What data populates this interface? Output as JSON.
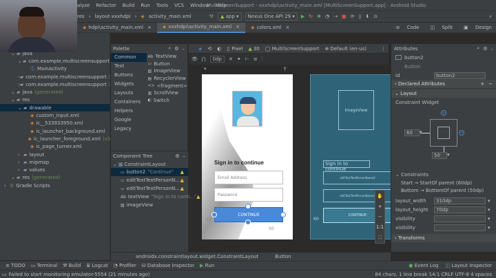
{
  "menubar": {
    "items": [
      "alyze",
      "Refactor",
      "Build",
      "Run",
      "Tools",
      "VCS",
      "Window",
      "Help"
    ],
    "title": "MultiScreenSupport - xxxhdpi\\activity_main.xml [MultiScreenSupport.app] - Android Studio"
  },
  "toolbar": {
    "path": [
      "res",
      "layout-xxxhdpi",
      "activity_main.xml"
    ],
    "run_config": "app",
    "device": "Nexus One API 29"
  },
  "tabs": [
    "hdpi\\activity_main.xml",
    "xxxhdpi\\activity_main.xml",
    "colors.xml"
  ],
  "active_tab": 1,
  "view_modes": [
    "Code",
    "Split",
    "Design"
  ],
  "project_tree": [
    {
      "label": "java",
      "indent": 1,
      "kind": "folder"
    },
    {
      "label": "com.example.multiscreensupport",
      "indent": 2,
      "kind": "package"
    },
    {
      "label": "MainActivity",
      "indent": 3,
      "kind": "class"
    },
    {
      "label": "com.example.multiscreensupport",
      "suffix": "(androidTest)",
      "indent": 2,
      "kind": "package"
    },
    {
      "label": "com.example.multiscreensupport",
      "suffix": "(test)",
      "indent": 2,
      "kind": "package"
    },
    {
      "label": "java",
      "suffix": "(generated)",
      "indent": 1,
      "kind": "folder"
    },
    {
      "label": "res",
      "indent": 1,
      "kind": "folder"
    },
    {
      "label": "drawable",
      "indent": 2,
      "kind": "folder",
      "selected": true
    },
    {
      "label": "custom_input.xml",
      "indent": 3,
      "kind": "file"
    },
    {
      "label": "ic__533933950.xml",
      "indent": 3,
      "kind": "file"
    },
    {
      "label": "ic_launcher_background.xml",
      "indent": 3,
      "kind": "file"
    },
    {
      "label": "ic_launcher_foreground.xml",
      "suffix": "(v24)",
      "indent": 3,
      "kind": "file"
    },
    {
      "label": "ic_page_turner.xml",
      "indent": 3,
      "kind": "file"
    },
    {
      "label": "layout",
      "indent": 2,
      "kind": "folder"
    },
    {
      "label": "mipmap",
      "indent": 2,
      "kind": "folder"
    },
    {
      "label": "values",
      "indent": 2,
      "kind": "folder"
    },
    {
      "label": "res",
      "suffix": "(generated)",
      "indent": 1,
      "kind": "folder"
    },
    {
      "label": "Gradle Scripts",
      "indent": 0,
      "kind": "gradle"
    }
  ],
  "palette": {
    "title": "Palette",
    "categories": [
      "Common",
      "Text",
      "Buttons",
      "Widgets",
      "Layouts",
      "Containers",
      "Helpers",
      "Google",
      "Legacy"
    ],
    "items": [
      "TextView",
      "Button",
      "ImageView",
      "RecyclerView",
      "<fragment>",
      "ScrollView",
      "Switch"
    ]
  },
  "component_tree": {
    "title": "Component Tree",
    "root": "ConstraintLayout",
    "children": [
      {
        "name": "button2",
        "detail": "\"Continue\"",
        "warn": true,
        "selected": true
      },
      {
        "name": "editTextTextPersonN...",
        "detail": "",
        "warn": true
      },
      {
        "name": "editTextTextPersonN...",
        "detail": "",
        "warn": true
      },
      {
        "name": "textView",
        "detail": "\"Sign in to conti...\"",
        "warn": true
      },
      {
        "name": "imageView",
        "detail": "",
        "warn": false
      }
    ]
  },
  "design_toolbar": {
    "theme_mode": "Pixel",
    "api": "30",
    "app_name": "MultiScreenSupport",
    "locale": "Default (en-us)",
    "offset": "0dp"
  },
  "phone": {
    "title": "Sign in to continue",
    "email_hint": "Email Address",
    "password_hint": "Password",
    "button": "CONTINUE",
    "margin_left": "60",
    "margin_bottom": "50"
  },
  "blueprint": {
    "imageview": "ImageView",
    "signin": "Sign in to continue",
    "edit1": "editTextTextPersonName2",
    "edit2": "editTextTextPersonName3",
    "button": "CONTINUE",
    "margin_left": "60"
  },
  "attributes": {
    "title": "Attributes",
    "component": "button2",
    "component_type": "Button",
    "id_label": "id",
    "id_value": "button2",
    "declared": "Declared Attributes",
    "layout": "Layout",
    "constraint_widget": "Constraint Widget",
    "margin_left": "60",
    "margin_bottom": "50",
    "constraints_title": "Constraints",
    "constraint1": "Start → StartOf parent (60dp)",
    "constraint2": "Bottom → BottomOf parent (50dp)",
    "fields": [
      {
        "label": "layout_width",
        "value": "310dp"
      },
      {
        "label": "layout_height",
        "value": "70dp"
      },
      {
        "label": "visibility",
        "value": ""
      },
      {
        "label": "visibility",
        "value": ""
      }
    ],
    "transforms": "Transforms"
  },
  "breadcrumb": [
    "androidx.constraintlayout.widget.ConstraintLayout",
    "Button"
  ],
  "bottom_tools": [
    "TODO",
    "Terminal",
    "Build",
    "Logcat",
    "Profiler",
    "Database Inspector",
    "Run"
  ],
  "bottom_right": [
    "Event Log",
    "Layout Inspector"
  ],
  "status": {
    "message": "Failed to start monitoring emulator-5554 (21 minutes ago)",
    "right": "84 chars, 1 line break   14:1   CRLF   UTF-8   4 spaces"
  }
}
